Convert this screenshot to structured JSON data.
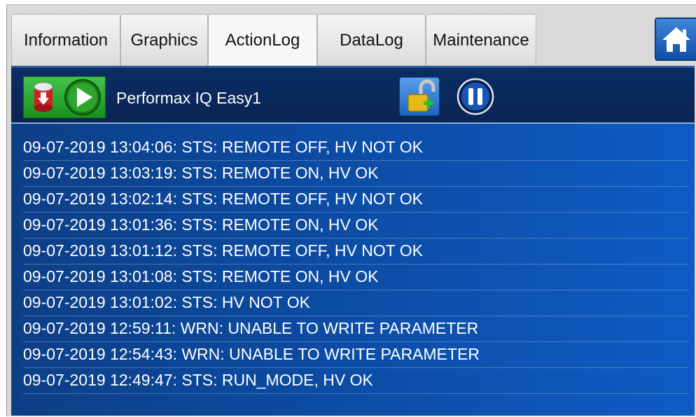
{
  "tabs": [
    {
      "label": "Information",
      "active": false
    },
    {
      "label": "Graphics",
      "active": false
    },
    {
      "label": "ActionLog",
      "active": true
    },
    {
      "label": "DataLog",
      "active": false
    },
    {
      "label": "Maintenance",
      "active": false
    }
  ],
  "home_button": {
    "icon": "home-icon"
  },
  "header": {
    "device_name": "Performax IQ Easy1",
    "status_icons": [
      "warning-cylinder-icon",
      "play-icon"
    ],
    "lock_icon": "unlocked-padlock-icon",
    "pause_icon": "pause-icon"
  },
  "log": [
    "09-07-2019 13:04:06: STS: REMOTE OFF, HV NOT OK",
    "09-07-2019 13:03:19: STS: REMOTE ON, HV OK",
    "09-07-2019 13:02:14: STS: REMOTE OFF, HV NOT OK",
    "09-07-2019 13:01:36: STS: REMOTE ON, HV OK",
    "09-07-2019 13:01:12: STS: REMOTE OFF, HV NOT OK",
    "09-07-2019 13:01:08: STS: REMOTE ON, HV OK",
    "09-07-2019 13:01:02: STS: HV NOT OK",
    "09-07-2019 12:59:11: WRN: UNABLE TO WRITE PARAMETER",
    "09-07-2019 12:54:43: WRN: UNABLE TO WRITE PARAMETER",
    "09-07-2019 12:49:47: STS: RUN_MODE, HV OK"
  ],
  "colors": {
    "panel": "#0c4aa0",
    "header": "#0a2d66",
    "status_green": "#17911f",
    "accent_blue": "#1c63bf"
  }
}
